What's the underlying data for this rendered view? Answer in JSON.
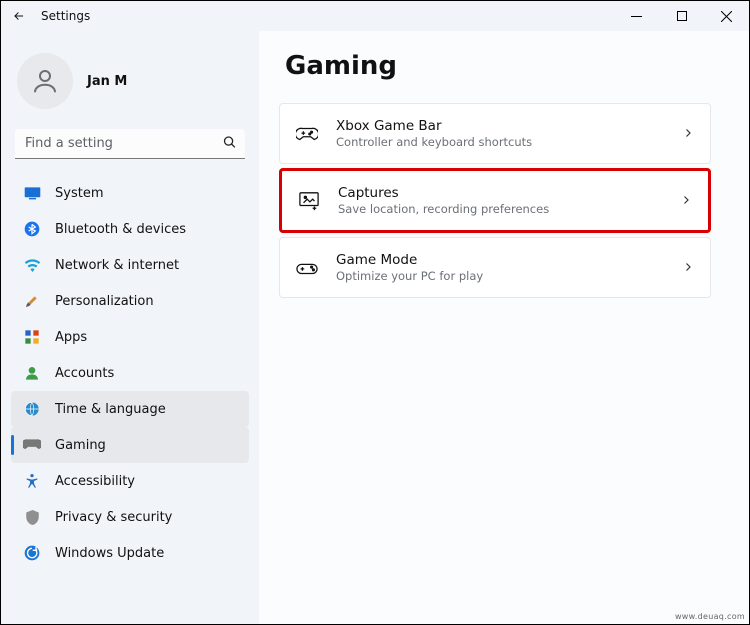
{
  "titlebar": {
    "title": "Settings"
  },
  "user": {
    "name": "Jan M"
  },
  "search": {
    "placeholder": "Find a setting"
  },
  "nav": {
    "items": [
      {
        "label": "System"
      },
      {
        "label": "Bluetooth & devices"
      },
      {
        "label": "Network & internet"
      },
      {
        "label": "Personalization"
      },
      {
        "label": "Apps"
      },
      {
        "label": "Accounts"
      },
      {
        "label": "Time & language"
      },
      {
        "label": "Gaming"
      },
      {
        "label": "Accessibility"
      },
      {
        "label": "Privacy & security"
      },
      {
        "label": "Windows Update"
      }
    ]
  },
  "page": {
    "title": "Gaming"
  },
  "cards": [
    {
      "title": "Xbox Game Bar",
      "subtitle": "Controller and keyboard shortcuts"
    },
    {
      "title": "Captures",
      "subtitle": "Save location, recording preferences"
    },
    {
      "title": "Game Mode",
      "subtitle": "Optimize your PC for play"
    }
  ],
  "watermark": "www.deuaq.com"
}
